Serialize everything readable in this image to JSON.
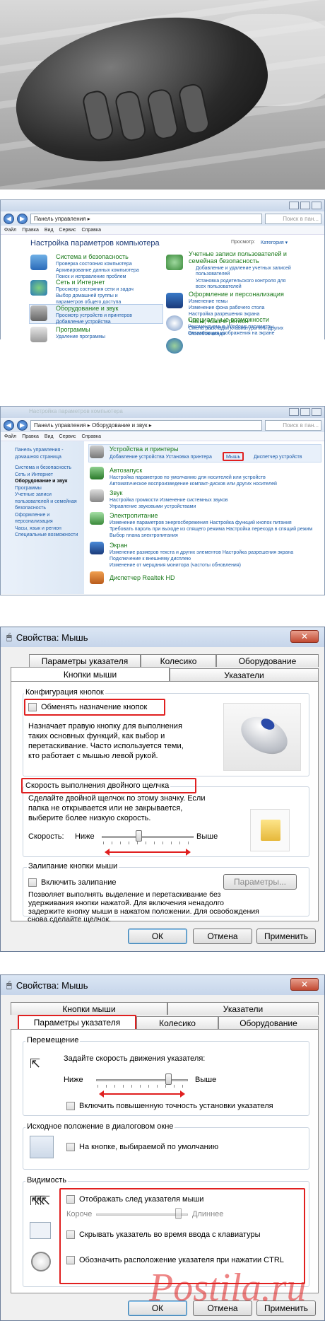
{
  "cp1": {
    "addr": "Панель управления ▸",
    "search": "Поиск в пан...",
    "menu": [
      "Файл",
      "Правка",
      "Вид",
      "Сервис",
      "Справка"
    ],
    "heading": "Настройка параметров компьютера",
    "view_label": "Просмотр:",
    "view_value": "Категория ▾",
    "left": [
      {
        "title": "Система и безопасность",
        "links": [
          "Проверка состояния компьютера",
          "Архивирование данных компьютера",
          "Поиск и исправление проблем"
        ]
      },
      {
        "title": "Сеть и Интернет",
        "links": [
          "Просмотр состояния сети и задач",
          "Выбор домашней группы и",
          "параметров общего доступа"
        ]
      },
      {
        "title": "Оборудование и звук",
        "links": [
          "Просмотр устройств и принтеров",
          "Добавление устройства"
        ]
      },
      {
        "title": "Программы",
        "links": [
          "Удаление программы"
        ]
      }
    ],
    "right": [
      {
        "title": "Учетные записи пользователей и",
        "title2": "семейная безопасность",
        "links": [
          "Добавление и удаление учетных записей",
          "пользователей",
          "Установка родительского контроля для",
          "всех пользователей"
        ]
      },
      {
        "title": "Оформление и персонализация",
        "links": [
          "Изменение темы",
          "Изменение фона рабочего стола",
          "Настройка разрешения экрана"
        ]
      },
      {
        "title": "Часы, язык и регион",
        "links": [
          "Смена раскладки клавиатуры или других",
          "способов ввода"
        ]
      },
      {
        "title": "Специальные возможности",
        "links": [
          "Рекомендуемые Windows параметры",
          "Оптимизация изображения на экране"
        ]
      }
    ]
  },
  "cp2": {
    "ghost_title": "Настройка параметров компьютера",
    "addr": "Панель управления ▸ Оборудование и звук ▸",
    "search": "Поиск в пан...",
    "menu": [
      "Файл",
      "Правка",
      "Вид",
      "Сервис",
      "Справка"
    ],
    "side": [
      "Панель управления -",
      "домашняя страница",
      "",
      "Система и безопасность",
      "Сеть и Интернет",
      "Оборудование и звук",
      "Программы",
      "Учетные записи",
      "пользователей и семейная",
      "безопасность",
      "Оформление и",
      "персонализация",
      "Часы, язык и регион",
      "Специальные возможности"
    ],
    "sections": [
      {
        "title": "Устройства и принтеры",
        "links": "Добавление устройства    Установка принтера",
        "mouse": "Мышь",
        "extra": "Диспетчер устройств"
      },
      {
        "title": "Автозапуск",
        "links": "Настройка параметров по умолчанию для носителей или устройств",
        "links2": "Автоматическое воспроизведение компакт-дисков или других носителей"
      },
      {
        "title": "Звук",
        "links": "Настройка громкости    Изменение системных звуков",
        "links2": "Управление звуковыми устройствами"
      },
      {
        "title": "Электропитание",
        "links": "Изменение параметров энергосбережения    Настройка функций кнопок питания",
        "links2": "Требовать пароль при выходе из спящего режима    Настройка перехода в спящий режим",
        "links3": "Выбор плана электропитания"
      },
      {
        "title": "Экран",
        "links": "Изменение размеров текста и других элементов    Настройка разрешения экрана",
        "links2": "Подключение к внешнему дисплею",
        "links3": "Изменение от мерцания монитора (частоты обновления)"
      },
      {
        "title": "Диспетчер Realtek HD"
      }
    ]
  },
  "dlg1": {
    "title": "Свойства: Мышь",
    "tabs_back": [
      "Параметры указателя",
      "Колесико",
      "Оборудование"
    ],
    "tabs_front": [
      "Кнопки мыши",
      "Указатели"
    ],
    "group1": "Конфигурация кнопок",
    "swap": "Обменять назначение кнопок",
    "swap_desc": [
      "Назначает правую кнопку для выполнения",
      "таких основных функций, как выбор и",
      "перетаскивание. Часто используется теми,",
      "кто работает с мышью левой рукой."
    ],
    "group2": "Скорость выполнения двойного щелчка",
    "dbl_desc": [
      "Сделайте двойной щелчок по этому значку. Если",
      "папка не открывается или не закрывается,",
      "выберите более низкую скорость."
    ],
    "speed": "Скорость:",
    "low": "Ниже",
    "high": "Выше",
    "group3": "Залипание кнопки мыши",
    "sticky": "Включить залипание",
    "params": "Параметры...",
    "sticky_desc": [
      "Позволяет выполнять выделение и перетаскивание без",
      "удерживания кнопки нажатой. Для включения ненадолго",
      "задержите кнопку мыши в нажатом положении. Для освобождения",
      "снова сделайте щелчок."
    ],
    "ok": "ОК",
    "cancel": "Отмена",
    "apply": "Применить",
    "close": "✕"
  },
  "dlg2": {
    "title": "Свойства: Мышь",
    "tabs_back": [
      "Кнопки мыши",
      "Указатели"
    ],
    "tabs_front": [
      "Параметры указателя",
      "Колесико",
      "Оборудование"
    ],
    "group1": "Перемещение",
    "move_desc": "Задайте скорость движения указателя:",
    "low": "Ниже",
    "high": "Выше",
    "precision": "Включить повышенную точность установки указателя",
    "group2": "Исходное положение в диалоговом окне",
    "snap": "На кнопке, выбираемой по умолчанию",
    "group3": "Видимость",
    "trail": "Отображать след указателя мыши",
    "short": "Короче",
    "long": "Длиннее",
    "hide": "Скрывать указатель во время ввода с клавиатуры",
    "ctrl": "Обозначить расположение указателя при нажатии CTRL",
    "ok": "ОК",
    "cancel": "Отмена",
    "apply": "Применить",
    "close": "✕"
  },
  "watermark": "Postila.ru",
  "colors": {
    "red_highlight": "#e02020",
    "link": "#1a5aa8",
    "category": "#1c7a1c"
  }
}
